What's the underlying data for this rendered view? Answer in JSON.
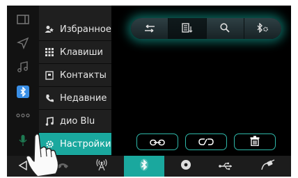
{
  "menu": {
    "items": [
      {
        "label": "Избранное",
        "icon": "favorite-contacts-icon"
      },
      {
        "label": "Клавиши",
        "icon": "keypad-icon"
      },
      {
        "label": "Контакты",
        "icon": "contacts-book-icon"
      },
      {
        "label": "Недавние",
        "icon": "recent-calls-icon"
      },
      {
        "label": "дио  Blu",
        "icon": "music-note-icon"
      },
      {
        "label": "Настройки",
        "icon": "gear-icon"
      }
    ],
    "active_index": 5
  },
  "rail": {
    "icons": [
      "window-icon",
      "navigation-arrow-icon",
      "music-icon",
      "bluetooth-icon",
      "more-dots-icon",
      "microphone-icon",
      "back-icon"
    ]
  },
  "tabs": {
    "icons": [
      "transfer-icon",
      "device-list-icon",
      "search-icon",
      "bluetooth-settings-icon"
    ],
    "active_index": 1
  },
  "actions": {
    "icons": [
      "connect-icon",
      "disconnect-icon",
      "delete-icon"
    ]
  },
  "bottombar": {
    "icons": [
      "phone-icon",
      "radio-icon",
      "bluetooth-icon",
      "disc-icon",
      "usb-icon",
      "aux-icon"
    ],
    "active_index": 2
  },
  "colors": {
    "accent": "#1aa89e",
    "glow": "#14b4a5",
    "bluetooth_blue": "#3a8fe6",
    "menu_bg": "#1f1f1f",
    "screen_bg": "#000000"
  }
}
